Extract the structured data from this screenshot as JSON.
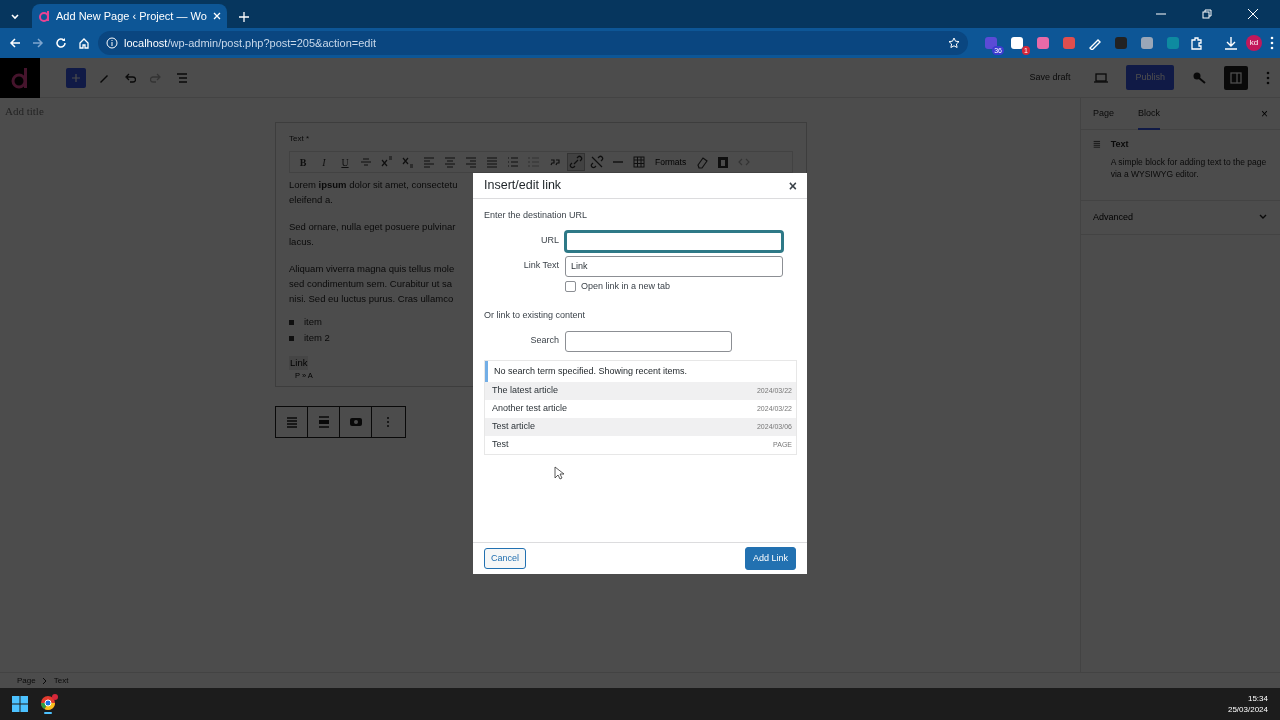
{
  "browser": {
    "tab": {
      "title": "Add New Page ‹ Project — Wo",
      "selected": true
    },
    "url_host": "localhost",
    "url_path": "/wp-admin/post.php?post=205&action=edit",
    "extension_badges": [
      "36",
      "1"
    ],
    "profile": "kd"
  },
  "editor": {
    "toolbar": {
      "save": "Save draft",
      "publish": "Publish"
    },
    "title_placeholder": "Add title",
    "block": {
      "label": "Text *",
      "text_buttons": [
        {
          "label": "B",
          "kind": "bold"
        },
        {
          "label": "I",
          "kind": "italic"
        },
        {
          "label": "U",
          "kind": "underline"
        }
      ],
      "format_menu": "Formats",
      "paragraphs": [
        {
          "lines": [
            "Lorem **ipsum** dolor sit amet, consectetu",
            "eleifend a."
          ]
        },
        {
          "lines": [
            "Sed ornare, nulla eget posuere pulvinar",
            "lacus."
          ]
        },
        {
          "lines": [
            "Aliquam viverra magna quis tellus mole",
            "sed condimentum sem. Curabitur ut sa",
            "nisi. Sed eu luctus purus. Cras ullamco"
          ]
        }
      ],
      "list": [
        "item",
        "item 2"
      ],
      "link_text": "Link",
      "path": "P » A"
    }
  },
  "sidebar": {
    "close": "×",
    "tabs": [
      {
        "label": "Page",
        "selected": false
      },
      {
        "label": "Block",
        "selected": true
      }
    ],
    "block_name": "Text",
    "block_desc": "A simple block for adding text to the page via a WYSIWYG editor.",
    "panels": [
      {
        "label": "Advanced",
        "expanded": false
      }
    ]
  },
  "breadcrumb": [
    "Page",
    "Text"
  ],
  "dialog": {
    "title": "Insert/edit link",
    "intro": "Enter the destination URL",
    "close": "×",
    "fields": [
      {
        "label": "URL",
        "focused": true
      },
      {
        "label": "Link Text",
        "value": "Link",
        "focused": false
      }
    ],
    "new_tab": {
      "label": "Open link in a new tab",
      "checked": false
    },
    "existing": "Or link to existing content",
    "search_label": "Search",
    "notice": "No search term specified. Showing recent items.",
    "results": [
      {
        "title": "The latest article",
        "info": "2024/03/22"
      },
      {
        "title": "Another test article",
        "info": "2024/03/22"
      },
      {
        "title": "Test article",
        "info": "2024/03/06"
      },
      {
        "title": "Test",
        "info": "PAGE"
      }
    ],
    "cancel": "Cancel",
    "submit": "Add Link"
  },
  "taskbar": {
    "time": "15:34",
    "date": "25/03/2024"
  }
}
